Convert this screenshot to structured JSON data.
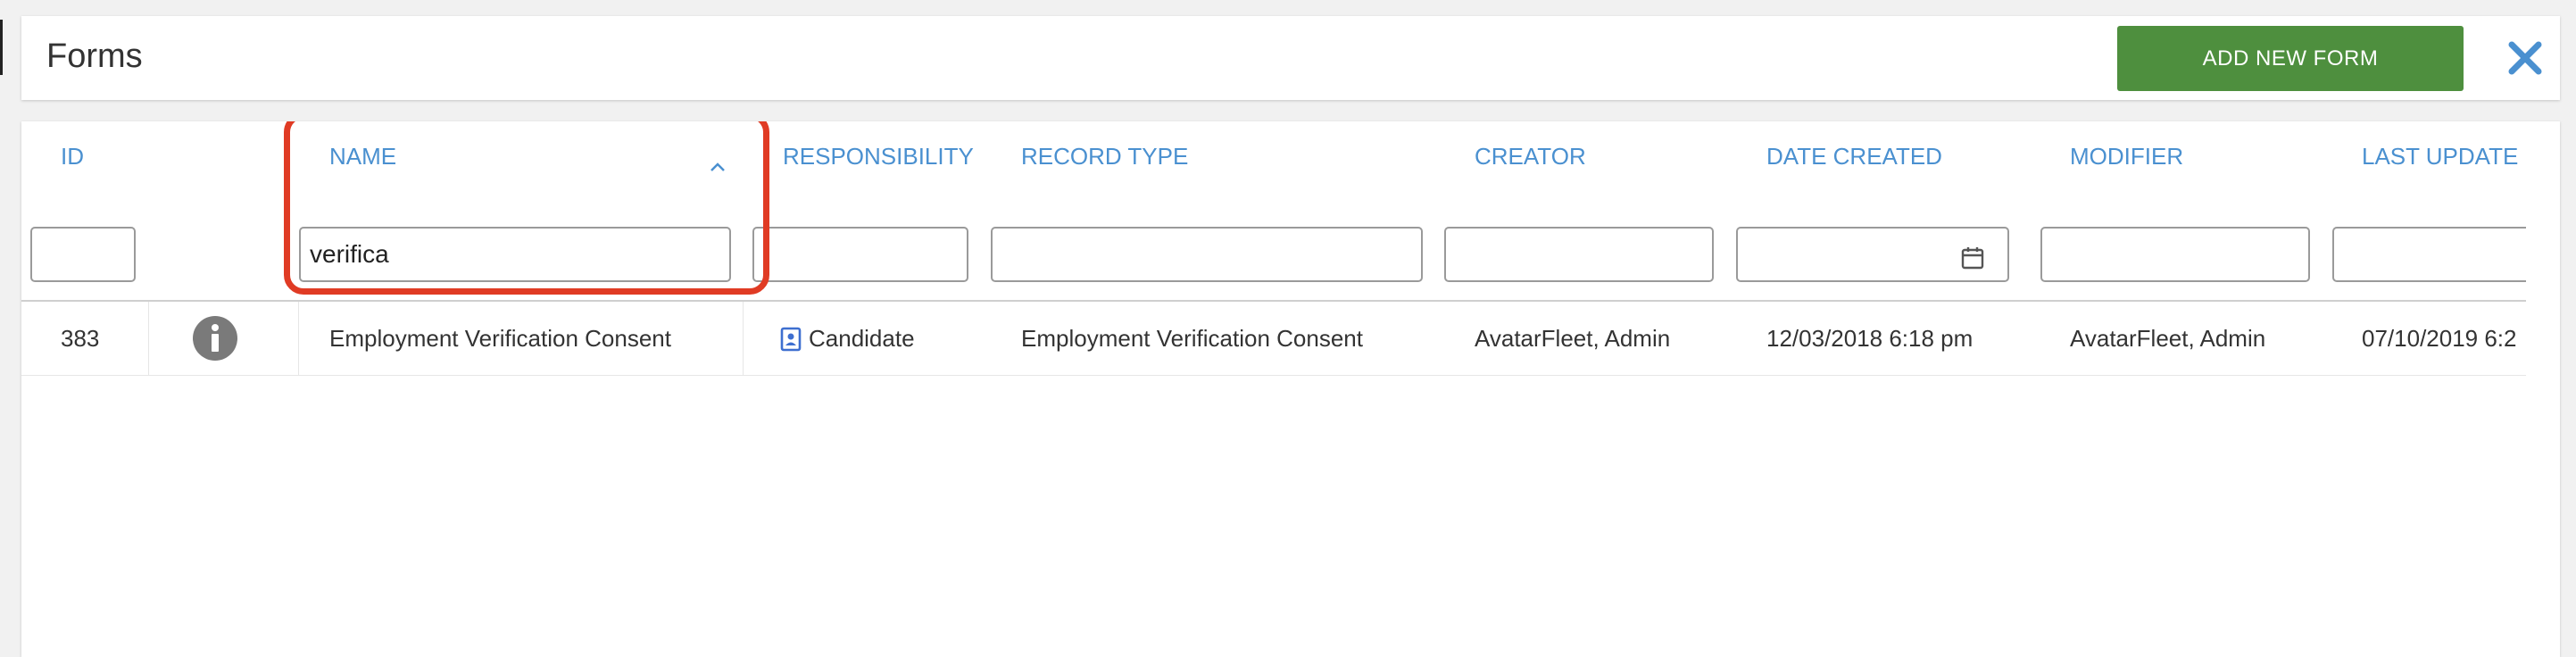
{
  "header": {
    "title": "Forms",
    "add_button_label": "ADD NEW FORM"
  },
  "colors": {
    "accent": "#4a90d0",
    "button_green": "#4e8f3e",
    "highlight_red": "#e03b24",
    "close_blue": "#4a90d0"
  },
  "table": {
    "columns": [
      {
        "key": "id",
        "label": "ID"
      },
      {
        "key": "info",
        "label": ""
      },
      {
        "key": "name",
        "label": "NAME",
        "sort": "ascending"
      },
      {
        "key": "responsibility",
        "label": "RESPONSIBILITY"
      },
      {
        "key": "record_type",
        "label": "RECORD TYPE"
      },
      {
        "key": "creator",
        "label": "CREATOR"
      },
      {
        "key": "date_created",
        "label": "DATE CREATED"
      },
      {
        "key": "modifier",
        "label": "MODIFIER"
      },
      {
        "key": "last_update",
        "label": "LAST UPDATE"
      }
    ],
    "filters": {
      "id": "",
      "name": "verifica",
      "responsibility": "",
      "record_type": "",
      "creator": "",
      "date_created": "",
      "modifier": "",
      "last_update": ""
    },
    "rows": [
      {
        "id": "383",
        "info_icon": "info-circle-icon",
        "name": "Employment Verification Consent",
        "responsibility_icon": "contact-card-icon",
        "responsibility": "Candidate",
        "record_type": "Employment Verification Consent",
        "creator": "AvatarFleet, Admin",
        "date_created": "12/03/2018 6:18 pm",
        "modifier": "AvatarFleet, Admin",
        "last_update": "07/10/2019 6:2"
      }
    ]
  }
}
